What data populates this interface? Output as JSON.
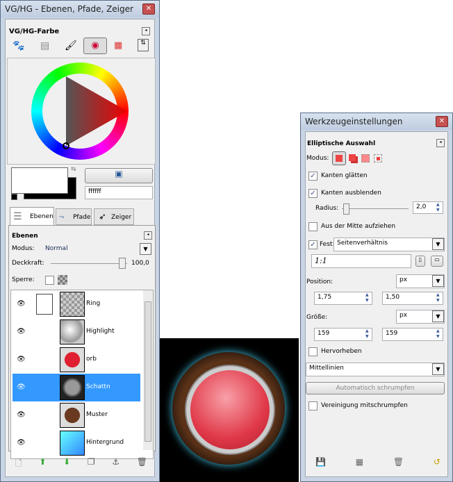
{
  "left_window": {
    "title": "VG/HG - Ebenen, Pfade, Zeiger",
    "color_panel": {
      "title": "VG/HG-Farbe",
      "hex_value": "ffffff",
      "fg_color": "#ffffff",
      "bg_color": "#000000"
    },
    "tabs": [
      {
        "label": "Ebenen"
      },
      {
        "label": "Pfade"
      },
      {
        "label": "Zeiger"
      }
    ],
    "layers_panel": {
      "title": "Ebenen",
      "mode_label": "Modus:",
      "mode_value": "Normal",
      "opacity_label": "Deckkraft:",
      "opacity_value": "100,0",
      "lock_label": "Sperre:"
    },
    "layers": [
      {
        "name": "Ring"
      },
      {
        "name": "Highlight"
      },
      {
        "name": "orb"
      },
      {
        "name": "Schattn",
        "selected": true
      },
      {
        "name": "Muster"
      },
      {
        "name": "Hintergrund"
      }
    ]
  },
  "right_window": {
    "title": "Werkzeugeinstellungen",
    "tool": "Elliptische Auswahl",
    "mode_label": "Modus:",
    "antialias": {
      "label": "Kanten glätten",
      "checked": true
    },
    "feather": {
      "label": "Kanten ausblenden",
      "checked": true
    },
    "radius_label": "Radius:",
    "radius_value": "2,0",
    "expand_center": {
      "label": "Aus der Mitte aufziehen",
      "checked": false
    },
    "fixed": {
      "label": "Fest:",
      "checked": true,
      "value": "Seitenverhältnis",
      "ratio": "1:1"
    },
    "position_label": "Position:",
    "position_unit": "px",
    "position_x": "1,75",
    "position_y": "1,50",
    "size_label": "Größe:",
    "size_unit": "px",
    "size_w": "159",
    "size_h": "159",
    "highlight": {
      "label": "Hervorheben",
      "checked": false
    },
    "guides": "Mittellinien",
    "auto_shrink": "Automatisch schrumpfen",
    "shrink_merged": {
      "label": "Vereinigung mitschrumpfen",
      "checked": false
    }
  }
}
